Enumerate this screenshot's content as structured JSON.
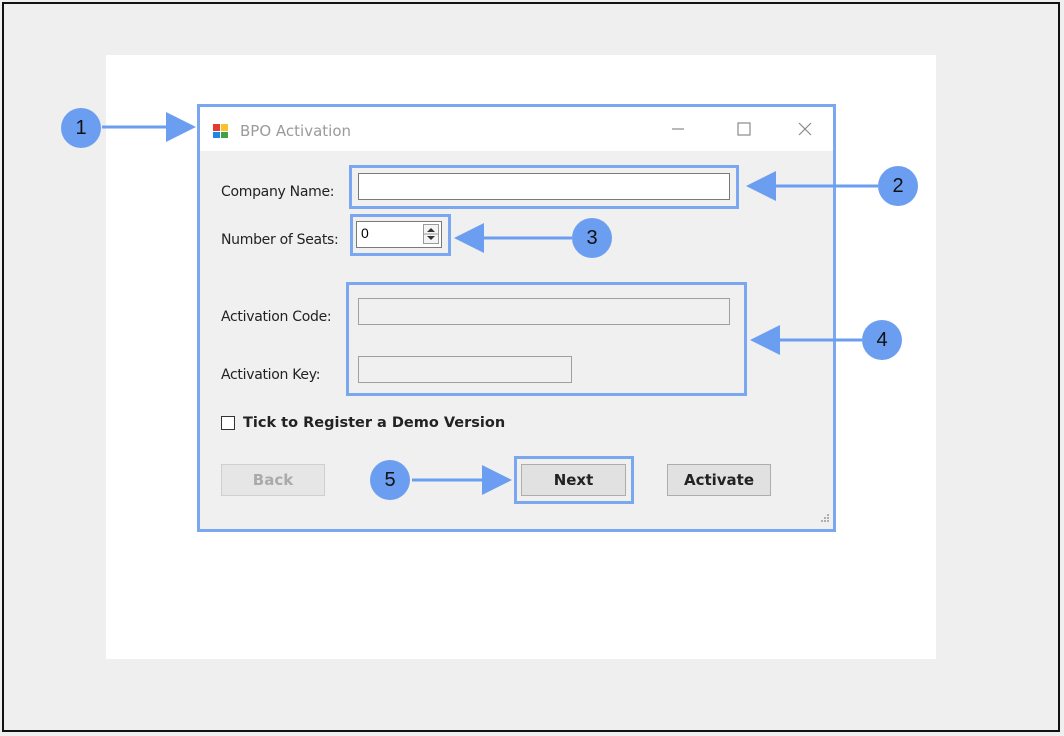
{
  "window": {
    "title": "BPO Activation"
  },
  "form": {
    "company_name_label": "Company Name:",
    "company_name_value": "",
    "seats_label": "Number of Seats:",
    "seats_value": "0",
    "activation_code_label": "Activation Code:",
    "activation_code_value": "",
    "activation_key_label": "Activation Key:",
    "activation_key_value": "",
    "demo_checkbox_label": "Tick to Register a Demo Version",
    "demo_checked": false
  },
  "buttons": {
    "back": "Back",
    "next": "Next",
    "activate": "Activate"
  },
  "callouts": [
    "1",
    "2",
    "3",
    "4",
    "5"
  ],
  "colors": {
    "callout": "#6b9ef0",
    "highlight": "#7aa7ef"
  }
}
